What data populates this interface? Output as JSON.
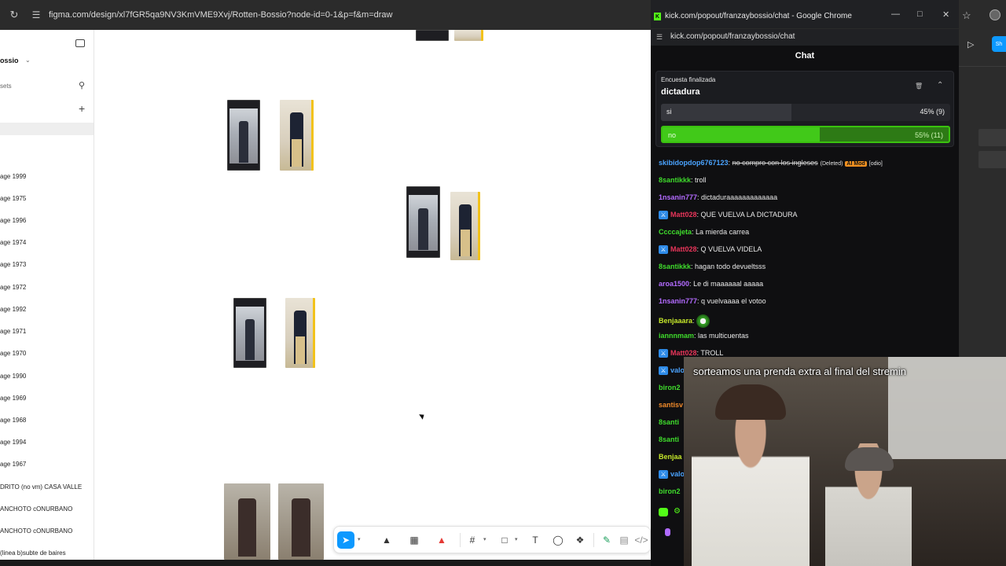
{
  "browser": {
    "url": "figma.com/design/xl7fGR5qa9NV3KmVME9Xvj/Rotten-Bossio?node-id=0-1&p=f&m=draw"
  },
  "figma_sidebar": {
    "file_name": "ossio",
    "assets_label": "sets",
    "pages": [
      "age 1999",
      "age 1975",
      "age 1996",
      "age 1974",
      "age 1973",
      "age 1972",
      "age 1992",
      "age 1971",
      "age 1970",
      "age 1990",
      "age 1969",
      "age 1968",
      "age 1994",
      "age 1967",
      "DRITO (no vm) CASA VALLE",
      "ANCHOTO cONURBANO",
      "ANCHOTO cONURBANO",
      "(linea b)subte de baires"
    ]
  },
  "canvas": {
    "tiny_labels": [
      "",
      "",
      "",
      ""
    ]
  },
  "toolbar": {
    "tools": [
      "move-tool",
      "pen-tool",
      "bucket-tool",
      "marker-tool",
      "frame-tool",
      "shape-tool",
      "text-tool",
      "comment-tool",
      "components-tool",
      "draw-tool",
      "dev-tool",
      "code-tool"
    ]
  },
  "popout": {
    "window_title": "kick.com/popout/franzaybossio/chat - Google Chrome",
    "url": "kick.com/popout/franzaybossio/chat",
    "chat_title": "Chat",
    "poll": {
      "status": "Encuesta finalizada",
      "title": "dictadura",
      "options": [
        {
          "label": "si",
          "pct_text": "45% (9)",
          "fraction": 0.45,
          "winner": false
        },
        {
          "label": "no",
          "pct_text": "55% (11)",
          "fraction": 0.55,
          "winner": true
        }
      ]
    },
    "messages": [
      {
        "user": "skibidopdop6767123",
        "color": "#4aa3ff",
        "text": "no compro con los ingleses",
        "deleted": true,
        "extra": "(Deleted)",
        "badge": "AI Mod",
        "tag": "[odio]"
      },
      {
        "user": "8santikkk",
        "color": "#3fdc2c",
        "text": "troll"
      },
      {
        "user": "1nsanin777",
        "color": "#b36bff",
        "text": "dictaduraaaaaaaaaaaaa"
      },
      {
        "user": "Matt028",
        "color": "#e8355a",
        "text": "QUE VUELVA LA DICTADURA",
        "mod": true
      },
      {
        "user": "Ccccajeta",
        "color": "#3fdc2c",
        "text": "La mierda carrea"
      },
      {
        "user": "Matt028",
        "color": "#e8355a",
        "text": "Q VUELVA VIDELA",
        "mod": true
      },
      {
        "user": "8santikkk",
        "color": "#3fdc2c",
        "text": "hagan todo devueltsss"
      },
      {
        "user": "aroa1500",
        "color": "#b36bff",
        "text": "Le di maaaaaal aaaaa"
      },
      {
        "user": "1nsanin777",
        "color": "#b36bff",
        "text": "q vuelvaaaa el votoo"
      },
      {
        "user": "Benjaaara",
        "color": "#c4e62a",
        "text": "",
        "emote": true
      },
      {
        "user": "iannnmam",
        "color": "#3fdc2c",
        "text": "las multicuentas"
      },
      {
        "user": "Matt028",
        "color": "#e8355a",
        "text": "TROLL",
        "mod": true
      }
    ],
    "partial_users": [
      {
        "user": "valo",
        "color": "#4aa3ff",
        "mod": true
      },
      {
        "user": "biron2",
        "color": "#3fdc2c"
      },
      {
        "user": "santisv",
        "color": "#f08a2a"
      },
      {
        "user": "8santi",
        "color": "#3fdc2c"
      },
      {
        "user": "8santi",
        "color": "#3fdc2c"
      },
      {
        "user": "Benjaa",
        "color": "#c4e62a"
      },
      {
        "user": "valo",
        "color": "#4aa3ff",
        "mod": true
      },
      {
        "user": "biron2",
        "color": "#3fdc2c"
      }
    ]
  },
  "webcam": {
    "caption": "sorteamos una prenda extra al final del stremin"
  },
  "colors": {
    "kick_green": "#53fc18",
    "figma_blue": "#0d99ff",
    "poll_win": "#3ac20f"
  }
}
